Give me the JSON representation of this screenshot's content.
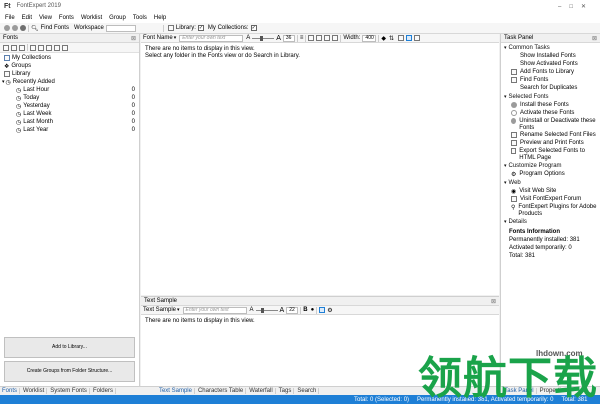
{
  "window": {
    "title": "FontExpert 2019"
  },
  "menu": [
    "File",
    "Edit",
    "View",
    "Fonts",
    "Worklist",
    "Group",
    "Tools",
    "Help"
  ],
  "toolbar": {
    "find_fonts": "Find Fonts",
    "workspace": "Workspace",
    "library": "Library:",
    "my_collections": "My Collections:"
  },
  "left": {
    "header": "Fonts",
    "tree": {
      "my_collections": "My Collections",
      "groups": "Groups",
      "library": "Library",
      "recently_added": "Recently Added",
      "items": [
        {
          "label": "Last Hour",
          "count": "0"
        },
        {
          "label": "Today",
          "count": "0"
        },
        {
          "label": "Yesterday",
          "count": "0"
        },
        {
          "label": "Last Week",
          "count": "0"
        },
        {
          "label": "Last Month",
          "count": "0"
        },
        {
          "label": "Last Year",
          "count": "0"
        }
      ]
    },
    "add_to_library": "Add to Library...",
    "create_groups": "Create Groups from Folder Structure..."
  },
  "center": {
    "font_name": "Font Name",
    "type_own_text_placeholder": "Enter your own text",
    "size": "36",
    "width_label": "Width:",
    "width_value": "400",
    "empty_line1": "There are no items to display in this view.",
    "empty_line2": "Select any folder in the Fonts view or do Search in Library."
  },
  "sample": {
    "header": "Text Sample",
    "sample_label": "Text Sample",
    "placeholder": "Enter your own text",
    "size": "22",
    "empty": "There are no items to display in this view."
  },
  "task_panel": {
    "header": "Task Panel",
    "common_tasks": "Common Tasks",
    "show_installed": "Show Installed Fonts",
    "show_activated": "Show Activated Fonts",
    "add_fonts": "Add Fonts to Library",
    "find_fonts": "Find Fonts",
    "search_duplicates": "Search for Duplicates",
    "selected_fonts": "Selected Fonts",
    "install": "Install these Fonts",
    "activate": "Activate these Fonts",
    "uninstall": "Uninstall or Deactivate these Fonts",
    "rename": "Rename Selected Font Files",
    "preview": "Preview and Print Fonts",
    "export": "Export Selected Fonts to HTML Page",
    "customize": "Customize Program",
    "options": "Program Options",
    "web": "Web",
    "visit_site": "Visit Web Site",
    "visit_forum": "Visit FontExpert Forum",
    "plugins": "FontExpert Plugins for Adobe Products",
    "details": "Details",
    "fonts_info": "Fonts Information",
    "perm_installed": "Permanently installed: 381",
    "act_temp": "Activated temporarily: 0",
    "total": "Total: 381"
  },
  "bottom_tabs_left": [
    "Fonts",
    "Worklist",
    "System Fonts",
    "Folders"
  ],
  "bottom_tabs_center": [
    "Text Sample",
    "Characters Table",
    "Waterfall",
    "Tags",
    "Search"
  ],
  "bottom_tabs_right": [
    "Task Panel",
    "Properties"
  ],
  "status": {
    "total_selected": "Total: 0 (Selected: 0)",
    "installed_summary": "Permanently installed: 381, Activated temporarily: 0",
    "total": "Total: 381"
  },
  "watermark": {
    "text": "领航下载",
    "url": "lhdown.com"
  },
  "colors": {
    "accent": "#1e7fd6",
    "watermark": "#1aa34a"
  }
}
